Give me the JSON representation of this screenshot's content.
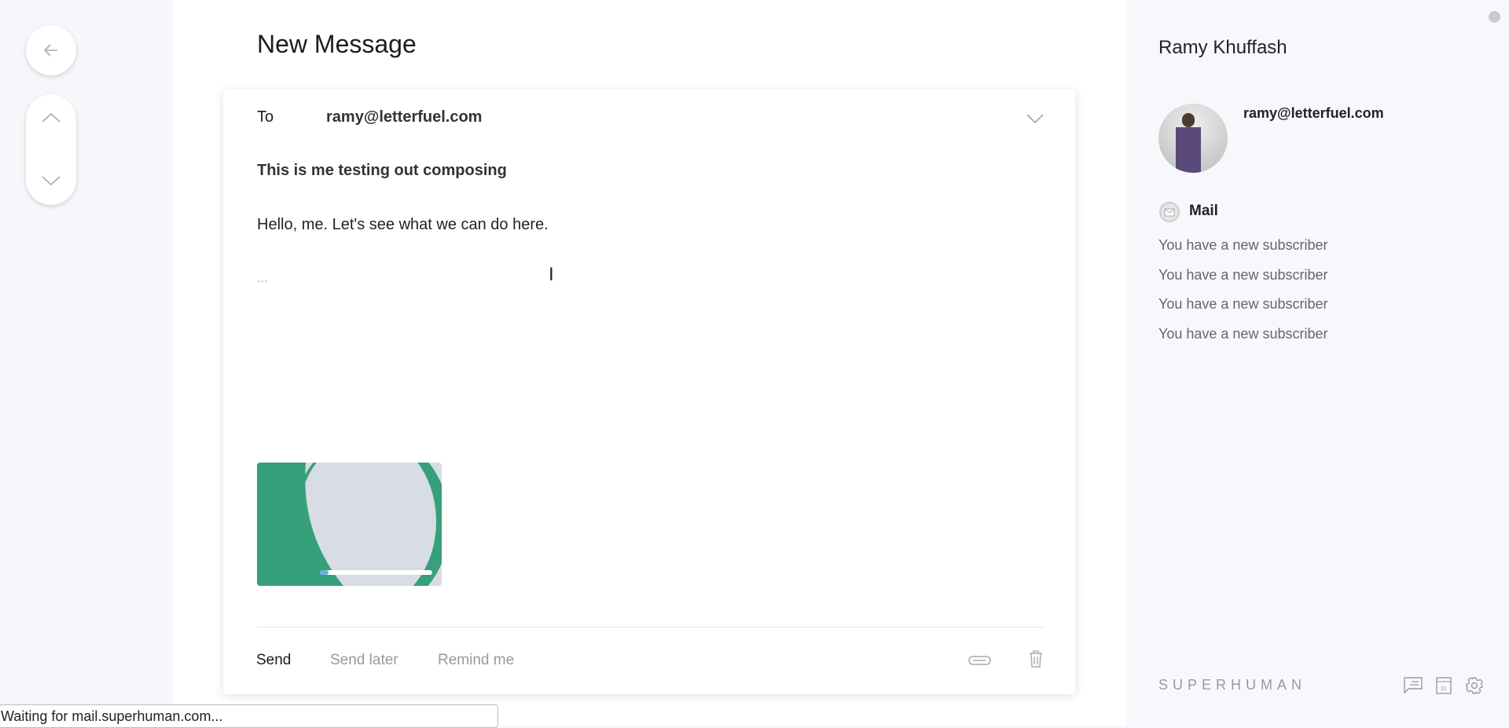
{
  "nav": {
    "back_icon": "arrow-left-icon",
    "up_icon": "chevron-up-icon",
    "down_icon": "chevron-down-icon"
  },
  "compose": {
    "title": "New Message",
    "to_label": "To",
    "to_value": "ramy@letterfuel.com",
    "subject": "This is me testing out composing",
    "body": "Hello, me. Let's see what we can do here.",
    "ellipsis": "...",
    "attachment_upload_progress": 0.08,
    "send_label": "Send",
    "send_later_label": "Send later",
    "remind_label": "Remind me",
    "colors": {
      "attachment_green": "#36a07a",
      "attachment_bg": "#d8dce4",
      "progress": "#6bb0e0"
    }
  },
  "contact": {
    "name": "Ramy Khuffash",
    "email": "ramy@letterfuel.com",
    "section_label": "Mail",
    "mail_items": [
      "You have a new subscriber",
      "You have a new subscriber",
      "You have a new subscriber",
      "You have a new subscriber"
    ]
  },
  "footer": {
    "brand": "SUPERHUMAN",
    "icons": [
      "chat-icon",
      "calendar-icon",
      "gear-icon"
    ],
    "calendar_day": "31"
  },
  "status_bar": "Waiting for mail.superhuman.com..."
}
